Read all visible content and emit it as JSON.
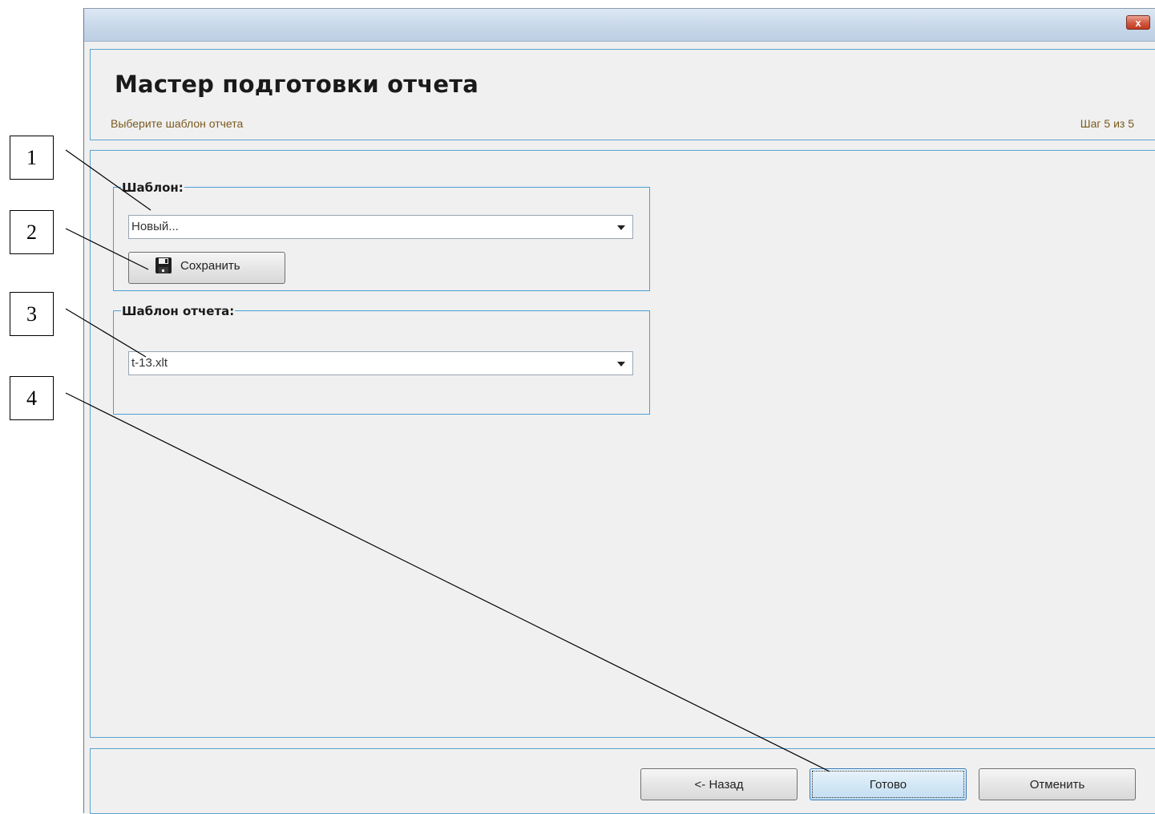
{
  "window": {
    "close_label": "x"
  },
  "header": {
    "title": "Мастер подготовки отчета",
    "subtitle": "Выберите шаблон отчета",
    "step": "Шаг 5 из 5"
  },
  "template_group": {
    "label": "Шаблон:",
    "combo_value": "Новый...",
    "save_button": "Сохранить"
  },
  "report_template_group": {
    "label": "Шаблон отчета:",
    "combo_value": "t-13.xlt"
  },
  "footer": {
    "back_button": "<- Назад",
    "finish_button": "Готово",
    "cancel_button": "Отменить"
  },
  "callouts": [
    "1",
    "2",
    "3",
    "4"
  ],
  "colors": {
    "panel_border": "#5aa3d0",
    "subtitle_text": "#7a5a1e",
    "close_button": "#c0391f"
  }
}
